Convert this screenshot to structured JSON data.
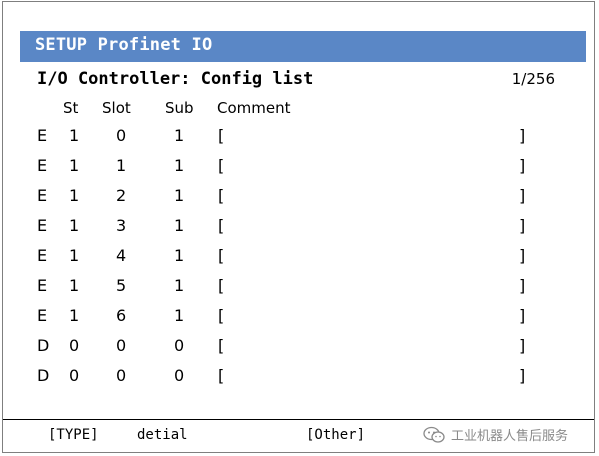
{
  "header": {
    "title": "SETUP Profinet IO",
    "subtitle": "I/O Controller: Config list",
    "page_indicator": "1/256"
  },
  "columns": {
    "st": "St",
    "slot": "Slot",
    "sub": "Sub",
    "comment": "Comment"
  },
  "rows": [
    {
      "flag": "E",
      "st": "1",
      "slot": "0",
      "sub": "1",
      "open": "[",
      "close": "]"
    },
    {
      "flag": "E",
      "st": "1",
      "slot": "1",
      "sub": "1",
      "open": "[",
      "close": "]"
    },
    {
      "flag": "E",
      "st": "1",
      "slot": "2",
      "sub": "1",
      "open": "[",
      "close": "]"
    },
    {
      "flag": "E",
      "st": "1",
      "slot": "3",
      "sub": "1",
      "open": "[",
      "close": "]"
    },
    {
      "flag": "E",
      "st": "1",
      "slot": "4",
      "sub": "1",
      "open": "[",
      "close": "]"
    },
    {
      "flag": "E",
      "st": "1",
      "slot": "5",
      "sub": "1",
      "open": "[",
      "close": "]"
    },
    {
      "flag": "E",
      "st": "1",
      "slot": "6",
      "sub": "1",
      "open": "[",
      "close": "]"
    },
    {
      "flag": "D",
      "st": "0",
      "slot": "0",
      "sub": "0",
      "open": "[",
      "close": "]"
    },
    {
      "flag": "D",
      "st": "0",
      "slot": "0",
      "sub": "0",
      "open": "[",
      "close": "]"
    }
  ],
  "function_keys": {
    "type": "[TYPE]",
    "detail": "detial",
    "other": "[Other]"
  },
  "watermark": {
    "text": "工业机器人售后服务",
    "icon": "wechat-icon"
  },
  "colors": {
    "title_bar": "#5a87c6",
    "title_text": "#ffffff",
    "watermark": "#8a8a8a"
  }
}
